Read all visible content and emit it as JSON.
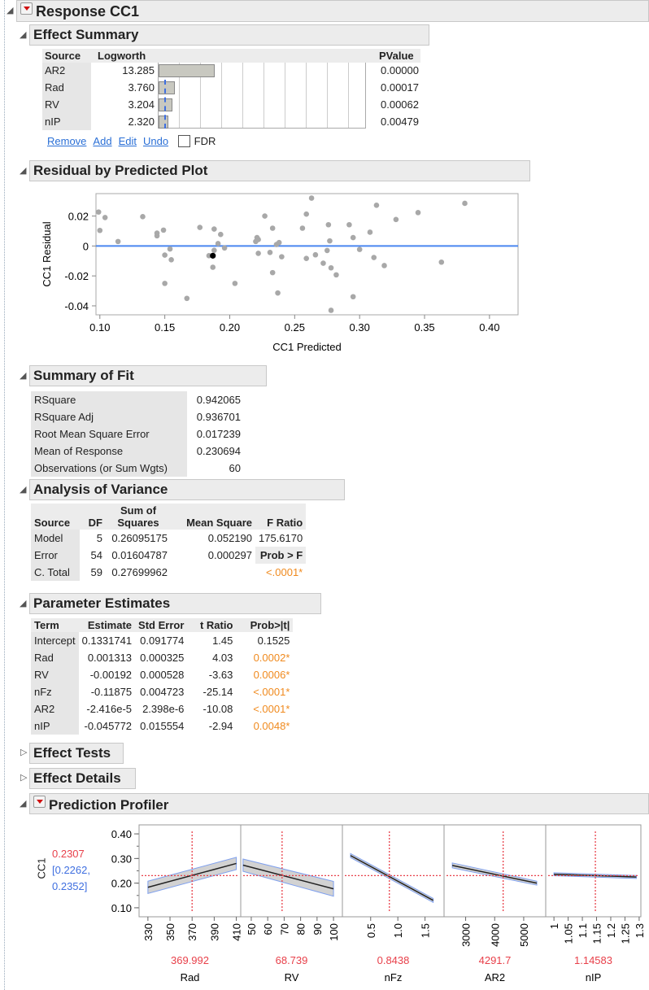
{
  "report": {
    "title": "Response CC1"
  },
  "effect_summary": {
    "title": "Effect Summary",
    "headers": {
      "source": "Source",
      "logworth": "Logworth",
      "pvalue": "PValue"
    },
    "rows": [
      {
        "source": "AR2",
        "logworth": "13.285",
        "pvalue": "0.00000",
        "lw": 13.285
      },
      {
        "source": "Rad",
        "logworth": "3.760",
        "pvalue": "0.00017",
        "lw": 3.76
      },
      {
        "source": "RV",
        "logworth": "3.204",
        "pvalue": "0.00062",
        "lw": 3.204
      },
      {
        "source": "nIP",
        "logworth": "2.320",
        "pvalue": "0.00479",
        "lw": 2.32
      }
    ],
    "links": {
      "remove": "Remove",
      "add": "Add",
      "edit": "Edit",
      "undo": "Undo"
    },
    "fdr_label": "FDR",
    "fdr_checked": false
  },
  "residual_plot": {
    "title": "Residual by Predicted Plot",
    "chart_data": {
      "type": "scatter",
      "xlabel": "CC1 Predicted",
      "ylabel": "CC1 Residual",
      "xlim": [
        0.097,
        0.422
      ],
      "ylim": [
        -0.046,
        0.035
      ],
      "xticks": [
        "0.10",
        "0.15",
        "0.20",
        "0.25",
        "0.30",
        "0.35",
        "0.40"
      ],
      "yticks": [
        "0.02",
        "0",
        "-0.02",
        "-0.04"
      ],
      "reference_line": 0,
      "highlighted": [
        0.187,
        -0.0065
      ],
      "points": [
        [
          0.099,
          0.0227
        ],
        [
          0.1,
          0.0104
        ],
        [
          0.104,
          0.019
        ],
        [
          0.114,
          0.003
        ],
        [
          0.133,
          0.0196
        ],
        [
          0.144,
          0.0086
        ],
        [
          0.144,
          0.0068
        ],
        [
          0.149,
          0.0106
        ],
        [
          0.15,
          -0.0061
        ],
        [
          0.154,
          -0.002
        ],
        [
          0.155,
          -0.0092
        ],
        [
          0.15,
          -0.025
        ],
        [
          0.167,
          -0.035
        ],
        [
          0.177,
          0.0124
        ],
        [
          0.184,
          -0.0065
        ],
        [
          0.188,
          0.0113
        ],
        [
          0.188,
          -0.0029
        ],
        [
          0.191,
          0.0016
        ],
        [
          0.187,
          -0.0142
        ],
        [
          0.193,
          0.0077
        ],
        [
          0.196,
          -0.0013
        ],
        [
          0.204,
          -0.025
        ],
        [
          0.22,
          0.003
        ],
        [
          0.221,
          0.0056
        ],
        [
          0.222,
          0.0043
        ],
        [
          0.222,
          -0.0049
        ],
        [
          0.227,
          0.02
        ],
        [
          0.231,
          -0.0043
        ],
        [
          0.233,
          0.0119
        ],
        [
          0.233,
          -0.0178
        ],
        [
          0.236,
          0.001
        ],
        [
          0.238,
          0.0023
        ],
        [
          0.237,
          -0.0314
        ],
        [
          0.24,
          -0.0072
        ],
        [
          0.256,
          0.0119
        ],
        [
          0.259,
          0.0213
        ],
        [
          0.263,
          0.032
        ],
        [
          0.259,
          -0.0083
        ],
        [
          0.266,
          -0.0059
        ],
        [
          0.272,
          -0.0115
        ],
        [
          0.275,
          -0.003
        ],
        [
          0.276,
          0.0142
        ],
        [
          0.277,
          0.0034
        ],
        [
          0.278,
          -0.0146
        ],
        [
          0.278,
          -0.043
        ],
        [
          0.282,
          -0.0193
        ],
        [
          0.292,
          0.0142
        ],
        [
          0.295,
          0.0056
        ],
        [
          0.295,
          -0.0339
        ],
        [
          0.3,
          -0.0023
        ],
        [
          0.308,
          0.0092
        ],
        [
          0.311,
          -0.0077
        ],
        [
          0.313,
          0.0272
        ],
        [
          0.319,
          -0.0131
        ],
        [
          0.328,
          0.0177
        ],
        [
          0.345,
          0.0223
        ],
        [
          0.363,
          -0.0108
        ],
        [
          0.381,
          0.0285
        ]
      ]
    }
  },
  "summary_of_fit": {
    "title": "Summary of Fit",
    "rows": [
      {
        "label": "RSquare",
        "value": "0.942065"
      },
      {
        "label": "RSquare Adj",
        "value": "0.936701"
      },
      {
        "label": "Root Mean Square Error",
        "value": "0.017239"
      },
      {
        "label": "Mean of Response",
        "value": "0.230694"
      },
      {
        "label": "Observations (or Sum Wgts)",
        "value": "60"
      }
    ]
  },
  "anova": {
    "title": "Analysis of Variance",
    "headers": {
      "source": "Source",
      "df": "DF",
      "ss1": "Sum of",
      "ss2": "Squares",
      "ms": "Mean Square",
      "f": "F Ratio"
    },
    "rows": [
      {
        "source": "Model",
        "df": "5",
        "ss": "0.26095175",
        "ms": "0.052190",
        "f": "175.6170"
      },
      {
        "source": "Error",
        "df": "54",
        "ss": "0.01604787",
        "ms": "0.000297",
        "f": "Prob > F"
      },
      {
        "source": "C. Total",
        "df": "59",
        "ss": "0.27699962",
        "ms": "",
        "f": "<.0001*"
      }
    ]
  },
  "parameter_estimates": {
    "title": "Parameter Estimates",
    "headers": {
      "term": "Term",
      "estimate": "Estimate",
      "stderr": "Std Error",
      "t": "t Ratio",
      "p": "Prob>|t|"
    },
    "rows": [
      {
        "term": "Intercept",
        "estimate": "0.1331741",
        "stderr": "0.091774",
        "t": "1.45",
        "p": "0.1525",
        "sig": false
      },
      {
        "term": "Rad",
        "estimate": "0.001313",
        "stderr": "0.000325",
        "t": "4.03",
        "p": "0.0002*",
        "sig": true
      },
      {
        "term": "RV",
        "estimate": "-0.00192",
        "stderr": "0.000528",
        "t": "-3.63",
        "p": "0.0006*",
        "sig": true
      },
      {
        "term": "nFz",
        "estimate": "-0.11875",
        "stderr": "0.004723",
        "t": "-25.14",
        "p": "<.0001*",
        "sig": true
      },
      {
        "term": "AR2",
        "estimate": "-2.416e-5",
        "stderr": "2.398e-6",
        "t": "-10.08",
        "p": "<.0001*",
        "sig": true
      },
      {
        "term": "nIP",
        "estimate": "-0.045772",
        "stderr": "0.015554",
        "t": "-2.94",
        "p": "0.0048*",
        "sig": true
      }
    ]
  },
  "effect_tests": {
    "title": "Effect Tests"
  },
  "effect_details": {
    "title": "Effect Details"
  },
  "profiler": {
    "title": "Prediction Profiler",
    "ylabel": "CC1",
    "prediction": "0.2307",
    "ci_low": "[0.2262,",
    "ci_high": "0.2352]",
    "colors": {
      "current": "#e8404a",
      "ci": "#3f6fe0"
    },
    "chart_data": {
      "type": "line",
      "ylim": [
        0.07,
        0.43
      ],
      "yticks": [
        "0.40",
        "0.30",
        "0.20",
        "0.10"
      ],
      "current_y": 0.2307,
      "factors": [
        {
          "name": "Rad",
          "current": "369.992",
          "cur": 369.992,
          "domain": [
            322,
            414
          ],
          "ticks": [
            "330",
            "350",
            "370",
            "390",
            "410"
          ],
          "line": [
            [
              330,
              0.183,
              0.025
            ],
            [
              410,
              0.28,
              0.025
            ]
          ]
        },
        {
          "name": "RV",
          "current": "68.739",
          "cur": 68.739,
          "domain": [
            43.6,
            105.4
          ],
          "ticks": [
            "50",
            "60",
            "70",
            "80",
            "90",
            "100"
          ],
          "line": [
            [
              45,
              0.273,
              0.025
            ],
            [
              100,
              0.177,
              0.03
            ]
          ]
        },
        {
          "name": "nFz",
          "current": "0.8438",
          "cur": 0.8438,
          "domain": [
            -0.02,
            1.85
          ],
          "ticks": [
            "0.5",
            "1.0",
            "1.5"
          ],
          "line": [
            [
              0.13,
              0.312,
              0.008
            ],
            [
              1.65,
              0.13,
              0.008
            ]
          ]
        },
        {
          "name": "AR2",
          "current": "4291.7",
          "cur": 4291.7,
          "domain": [
            2256,
            5758
          ],
          "ticks": [
            "3000",
            "4000",
            "5000"
          ],
          "line": [
            [
              2540,
              0.272,
              0.01
            ],
            [
              5450,
              0.2,
              0.008
            ]
          ]
        },
        {
          "name": "nIP",
          "current": "1.14583",
          "cur": 1.14583,
          "domain": [
            0.971,
            1.306
          ],
          "ticks": [
            "1",
            "1.05",
            "1.1",
            "1.15",
            "1.2",
            "1.25",
            "1.3"
          ],
          "line": [
            [
              1.0,
              0.236,
              0.006
            ],
            [
              1.29,
              0.225,
              0.006
            ]
          ]
        }
      ]
    }
  }
}
